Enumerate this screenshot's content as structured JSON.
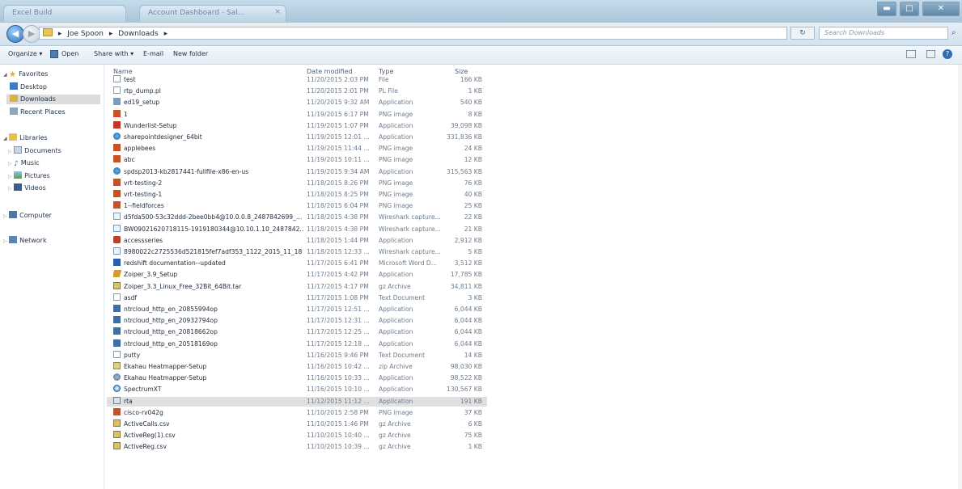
{
  "window": {
    "title_left": "Excel Build",
    "tab_label": "Account Dashboard - Sal...",
    "tab_close": "×",
    "buttons": {
      "minimize": "▬",
      "maximize": "□",
      "close": "✕"
    }
  },
  "address": {
    "back": "◀",
    "forward": "▶",
    "crumbs": [
      "Joe Spoon",
      "Downloads"
    ],
    "search_placeholder": "Search Downloads",
    "refresh": "↻"
  },
  "toolbar": {
    "organize": "Organize ▾",
    "open": "Open",
    "share_with": "Share with ▾",
    "email": "E-mail",
    "new_folder": "New folder"
  },
  "sidebar": {
    "favorites": "Favorites",
    "favorite_items": [
      "Desktop",
      "Downloads",
      "Recent Places"
    ],
    "libraries": "Libraries",
    "library_items": [
      "Documents",
      "Music",
      "Pictures",
      "Videos"
    ],
    "computer": "Computer",
    "network": "Network"
  },
  "columns": {
    "name": "Name",
    "date": "Date modified",
    "type": "Type",
    "size": "Size"
  },
  "files": [
    {
      "name": "test",
      "date": "11/20/2015 2:03 PM",
      "type": "File",
      "size": "166 KB",
      "icon": "file"
    },
    {
      "name": "rtp_dump.pl",
      "date": "11/20/2015 2:01 PM",
      "type": "PL File",
      "size": "1 KB",
      "icon": "file"
    },
    {
      "name": "ed19_setup",
      "date": "11/20/2015 9:32 AM",
      "type": "Application",
      "size": "540 KB",
      "icon": "app"
    },
    {
      "name": "1",
      "date": "11/19/2015 6:17 PM",
      "type": "PNG image",
      "size": "8 KB",
      "icon": "png"
    },
    {
      "name": "Wunderlist-Setup",
      "date": "11/19/2015 1:07 PM",
      "type": "Application",
      "size": "39,098 KB",
      "icon": "wunder"
    },
    {
      "name": "sharepointdesigner_64bit",
      "date": "11/19/2015 12:01 ...",
      "type": "Application",
      "size": "331,836 KB",
      "icon": "sp"
    },
    {
      "name": "applebees",
      "date": "11/19/2015 11:44 ...",
      "type": "PNG image",
      "size": "24 KB",
      "icon": "png"
    },
    {
      "name": "abc",
      "date": "11/19/2015 10:11 ...",
      "type": "PNG image",
      "size": "12 KB",
      "icon": "png"
    },
    {
      "name": "spdsp2013-kb2817441-fullfile-x86-en-us",
      "date": "11/19/2015 9:34 AM",
      "type": "Application",
      "size": "315,563 KB",
      "icon": "sp"
    },
    {
      "name": "vrt-testing-2",
      "date": "11/18/2015 8:26 PM",
      "type": "PNG image",
      "size": "76 KB",
      "icon": "png"
    },
    {
      "name": "vrt-testing-1",
      "date": "11/18/2015 8:25 PM",
      "type": "PNG image",
      "size": "40 KB",
      "icon": "png"
    },
    {
      "name": "1--fieldforces",
      "date": "11/18/2015 6:04 PM",
      "type": "PNG image",
      "size": "25 KB",
      "icon": "png"
    },
    {
      "name": "d5fda500-53c32ddd-2bee0bb4@10.0.0.8_2487842699_...",
      "date": "11/18/2015 4:38 PM",
      "type": "Wireshark capture...",
      "size": "22 KB",
      "icon": "wire"
    },
    {
      "name": "BW09021620718115-1919180344@10.10.1.10_2487842...",
      "date": "11/18/2015 4:38 PM",
      "type": "Wireshark capture...",
      "size": "21 KB",
      "icon": "wire"
    },
    {
      "name": "accessseries",
      "date": "11/18/2015 1:44 PM",
      "type": "Application",
      "size": "2,912 KB",
      "icon": "access"
    },
    {
      "name": "8980022c2725536d521815fef7adf353_1122_2015_11_18",
      "date": "11/18/2015 12:33 ...",
      "type": "Wireshark capture...",
      "size": "5 KB",
      "icon": "wire"
    },
    {
      "name": "redshift documentation--updated",
      "date": "11/17/2015 6:41 PM",
      "type": "Microsoft Word D...",
      "size": "3,512 KB",
      "icon": "doc"
    },
    {
      "name": "Zoiper_3.9_Setup",
      "date": "11/17/2015 4:42 PM",
      "type": "Application",
      "size": "17,785 KB",
      "icon": "zoiper"
    },
    {
      "name": "Zoiper_3.3_Linux_Free_32Bit_64Bit.tar",
      "date": "11/17/2015 4:17 PM",
      "type": "gz Archive",
      "size": "34,811 KB",
      "icon": "arc"
    },
    {
      "name": "asdf",
      "date": "11/17/2015 1:08 PM",
      "type": "Text Document",
      "size": "3 KB",
      "icon": "file"
    },
    {
      "name": "ntrcloud_http_en_20855994op",
      "date": "11/17/2015 12:51 ...",
      "type": "Application",
      "size": "6,044 KB",
      "icon": "ntr"
    },
    {
      "name": "ntrcloud_http_en_20932794op",
      "date": "11/17/2015 12:31 ...",
      "type": "Application",
      "size": "6,044 KB",
      "icon": "ntr"
    },
    {
      "name": "ntrcloud_http_en_20818662op",
      "date": "11/17/2015 12:25 ...",
      "type": "Application",
      "size": "6,044 KB",
      "icon": "ntr"
    },
    {
      "name": "ntrcloud_http_en_20518169op",
      "date": "11/17/2015 12:18 ...",
      "type": "Application",
      "size": "6,044 KB",
      "icon": "ntr"
    },
    {
      "name": "putty",
      "date": "11/16/2015 9:46 PM",
      "type": "Text Document",
      "size": "14 KB",
      "icon": "file"
    },
    {
      "name": "Ekahau Heatmapper-Setup",
      "date": "11/16/2015 10:42 ...",
      "type": "zip Archive",
      "size": "98,030 KB",
      "icon": "ekz"
    },
    {
      "name": "Ekahau Heatmapper-Setup",
      "date": "11/16/2015 10:33 ...",
      "type": "Application",
      "size": "98,522 KB",
      "icon": "ekc"
    },
    {
      "name": "SpectrumXT",
      "date": "11/16/2015 10:10 ...",
      "type": "Application",
      "size": "130,567 KB",
      "icon": "spec"
    },
    {
      "name": "rta",
      "date": "11/12/2015 11:12 ...",
      "type": "Application",
      "size": "191 KB",
      "icon": "rta",
      "selected": true
    },
    {
      "name": "cisco-rv042g",
      "date": "11/10/2015 2:58 PM",
      "type": "PNG image",
      "size": "37 KB",
      "icon": "png"
    },
    {
      "name": "ActiveCalls.csv",
      "date": "11/10/2015 1:46 PM",
      "type": "gz Archive",
      "size": "6 KB",
      "icon": "csv"
    },
    {
      "name": "ActiveReg(1).csv",
      "date": "11/10/2015 10:40 ...",
      "type": "gz Archive",
      "size": "75 KB",
      "icon": "csv"
    },
    {
      "name": "ActiveReg.csv",
      "date": "11/10/2015 10:39 ...",
      "type": "gz Archive",
      "size": "1 KB",
      "icon": "csv"
    }
  ]
}
